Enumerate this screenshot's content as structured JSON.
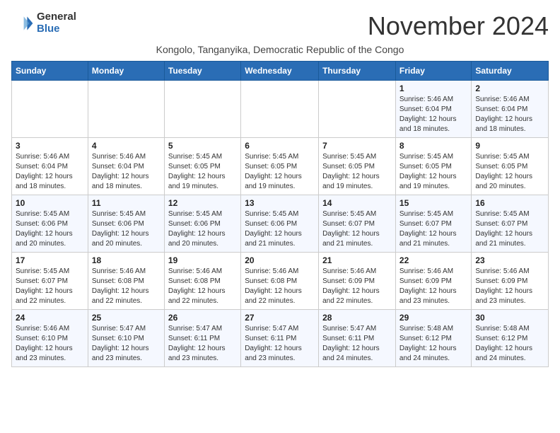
{
  "header": {
    "logo_general": "General",
    "logo_blue": "Blue",
    "month": "November 2024",
    "subtitle": "Kongolo, Tanganyika, Democratic Republic of the Congo"
  },
  "weekdays": [
    "Sunday",
    "Monday",
    "Tuesday",
    "Wednesday",
    "Thursday",
    "Friday",
    "Saturday"
  ],
  "weeks": [
    [
      {
        "day": "",
        "info": ""
      },
      {
        "day": "",
        "info": ""
      },
      {
        "day": "",
        "info": ""
      },
      {
        "day": "",
        "info": ""
      },
      {
        "day": "",
        "info": ""
      },
      {
        "day": "1",
        "info": "Sunrise: 5:46 AM\nSunset: 6:04 PM\nDaylight: 12 hours and 18 minutes."
      },
      {
        "day": "2",
        "info": "Sunrise: 5:46 AM\nSunset: 6:04 PM\nDaylight: 12 hours and 18 minutes."
      }
    ],
    [
      {
        "day": "3",
        "info": "Sunrise: 5:46 AM\nSunset: 6:04 PM\nDaylight: 12 hours and 18 minutes."
      },
      {
        "day": "4",
        "info": "Sunrise: 5:46 AM\nSunset: 6:04 PM\nDaylight: 12 hours and 18 minutes."
      },
      {
        "day": "5",
        "info": "Sunrise: 5:45 AM\nSunset: 6:05 PM\nDaylight: 12 hours and 19 minutes."
      },
      {
        "day": "6",
        "info": "Sunrise: 5:45 AM\nSunset: 6:05 PM\nDaylight: 12 hours and 19 minutes."
      },
      {
        "day": "7",
        "info": "Sunrise: 5:45 AM\nSunset: 6:05 PM\nDaylight: 12 hours and 19 minutes."
      },
      {
        "day": "8",
        "info": "Sunrise: 5:45 AM\nSunset: 6:05 PM\nDaylight: 12 hours and 19 minutes."
      },
      {
        "day": "9",
        "info": "Sunrise: 5:45 AM\nSunset: 6:05 PM\nDaylight: 12 hours and 20 minutes."
      }
    ],
    [
      {
        "day": "10",
        "info": "Sunrise: 5:45 AM\nSunset: 6:06 PM\nDaylight: 12 hours and 20 minutes."
      },
      {
        "day": "11",
        "info": "Sunrise: 5:45 AM\nSunset: 6:06 PM\nDaylight: 12 hours and 20 minutes."
      },
      {
        "day": "12",
        "info": "Sunrise: 5:45 AM\nSunset: 6:06 PM\nDaylight: 12 hours and 20 minutes."
      },
      {
        "day": "13",
        "info": "Sunrise: 5:45 AM\nSunset: 6:06 PM\nDaylight: 12 hours and 21 minutes."
      },
      {
        "day": "14",
        "info": "Sunrise: 5:45 AM\nSunset: 6:07 PM\nDaylight: 12 hours and 21 minutes."
      },
      {
        "day": "15",
        "info": "Sunrise: 5:45 AM\nSunset: 6:07 PM\nDaylight: 12 hours and 21 minutes."
      },
      {
        "day": "16",
        "info": "Sunrise: 5:45 AM\nSunset: 6:07 PM\nDaylight: 12 hours and 21 minutes."
      }
    ],
    [
      {
        "day": "17",
        "info": "Sunrise: 5:45 AM\nSunset: 6:07 PM\nDaylight: 12 hours and 22 minutes."
      },
      {
        "day": "18",
        "info": "Sunrise: 5:46 AM\nSunset: 6:08 PM\nDaylight: 12 hours and 22 minutes."
      },
      {
        "day": "19",
        "info": "Sunrise: 5:46 AM\nSunset: 6:08 PM\nDaylight: 12 hours and 22 minutes."
      },
      {
        "day": "20",
        "info": "Sunrise: 5:46 AM\nSunset: 6:08 PM\nDaylight: 12 hours and 22 minutes."
      },
      {
        "day": "21",
        "info": "Sunrise: 5:46 AM\nSunset: 6:09 PM\nDaylight: 12 hours and 22 minutes."
      },
      {
        "day": "22",
        "info": "Sunrise: 5:46 AM\nSunset: 6:09 PM\nDaylight: 12 hours and 23 minutes."
      },
      {
        "day": "23",
        "info": "Sunrise: 5:46 AM\nSunset: 6:09 PM\nDaylight: 12 hours and 23 minutes."
      }
    ],
    [
      {
        "day": "24",
        "info": "Sunrise: 5:46 AM\nSunset: 6:10 PM\nDaylight: 12 hours and 23 minutes."
      },
      {
        "day": "25",
        "info": "Sunrise: 5:47 AM\nSunset: 6:10 PM\nDaylight: 12 hours and 23 minutes."
      },
      {
        "day": "26",
        "info": "Sunrise: 5:47 AM\nSunset: 6:11 PM\nDaylight: 12 hours and 23 minutes."
      },
      {
        "day": "27",
        "info": "Sunrise: 5:47 AM\nSunset: 6:11 PM\nDaylight: 12 hours and 23 minutes."
      },
      {
        "day": "28",
        "info": "Sunrise: 5:47 AM\nSunset: 6:11 PM\nDaylight: 12 hours and 24 minutes."
      },
      {
        "day": "29",
        "info": "Sunrise: 5:48 AM\nSunset: 6:12 PM\nDaylight: 12 hours and 24 minutes."
      },
      {
        "day": "30",
        "info": "Sunrise: 5:48 AM\nSunset: 6:12 PM\nDaylight: 12 hours and 24 minutes."
      }
    ]
  ]
}
